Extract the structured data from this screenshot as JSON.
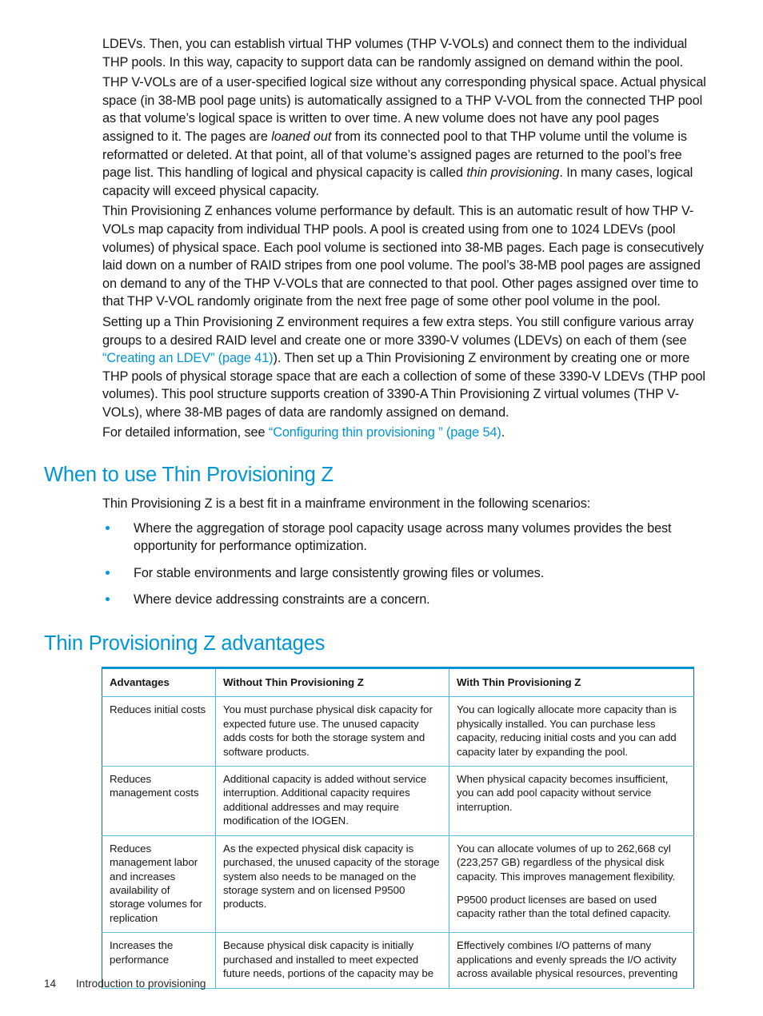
{
  "document": {
    "paragraphs": [
      {
        "id": "p1",
        "runs": [
          {
            "text": "LDEVs. Then, you can establish virtual THP volumes (THP V-VOLs) and connect them to the individual THP pools. In this way, capacity to support data can be randomly assigned on demand within the pool.",
            "style": "normal"
          }
        ]
      },
      {
        "id": "p2",
        "runs": [
          {
            "text": "THP V-VOLs are of a user-specified logical size without any corresponding physical space. Actual physical space (in 38-MB pool page units) is automatically assigned to a THP V-VOL from the connected THP pool as that volume’s logical space is written to over time. A new volume does not have any pool pages assigned to it. The pages are ",
            "style": "normal"
          },
          {
            "text": "loaned out",
            "style": "italic"
          },
          {
            "text": " from its connected pool to that THP volume until the volume is reformatted or deleted. At that point, all of that volume’s assigned pages are returned to the pool’s free page list. This handling of logical and physical capacity is called ",
            "style": "normal"
          },
          {
            "text": "thin provisioning",
            "style": "italic"
          },
          {
            "text": ". In many cases, logical capacity will exceed physical capacity.",
            "style": "normal"
          }
        ]
      },
      {
        "id": "p3",
        "runs": [
          {
            "text": "Thin Provisioning Z enhances volume performance by default. This is an automatic result of how THP V-VOLs map capacity from individual THP pools. A pool is created using from one to 1024 LDEVs (pool volumes) of physical space. Each pool volume is sectioned into 38-MB pages. Each page is consecutively laid down on a number of RAID stripes from one pool volume. The pool’s 38-MB pool pages are assigned on demand to any of the THP V-VOLs that are connected to that pool. Other pages assigned over time to that THP V-VOL randomly originate from the next free page of some other pool volume in the pool.",
            "style": "normal"
          }
        ]
      },
      {
        "id": "p4",
        "runs": [
          {
            "text": "Setting up a Thin Provisioning Z environment requires a few extra steps. You still configure various array groups to a desired RAID level and create one or more 3390-V volumes (LDEVs) on each of them (see ",
            "style": "normal"
          },
          {
            "text": "“Creating an LDEV” (page 41)",
            "style": "link"
          },
          {
            "text": "). Then set up a Thin Provisioning Z environment by creating one or more THP pools of physical storage space that are each a collection of some of these 3390-V LDEVs (THP pool volumes). This pool structure supports creation of 3390-A Thin Provisioning Z virtual volumes (THP V-VOLs), where 38-MB pages of data are randomly assigned on demand.",
            "style": "normal"
          }
        ]
      },
      {
        "id": "p5",
        "runs": [
          {
            "text": "For detailed information, see ",
            "style": "normal"
          },
          {
            "text": "“Configuring thin provisioning ” (page 54)",
            "style": "link"
          },
          {
            "text": ".",
            "style": "normal"
          }
        ]
      }
    ],
    "heading_when_to_use": "When to use Thin Provisioning Z",
    "intro_when_to_use": "Thin Provisioning Z is a best fit in a mainframe environment in the following scenarios:",
    "bullets": [
      "Where the aggregation of storage pool capacity usage across many volumes provides the best opportunity for performance optimization.",
      "For stable environments and large consistently growing files or volumes.",
      "Where device addressing constraints are a concern."
    ],
    "heading_advantages": "Thin Provisioning Z advantages",
    "table": {
      "headers": [
        "Advantages",
        "Without Thin Provisioning Z",
        "With Thin Provisioning Z"
      ],
      "rows": [
        {
          "advantage": "Reduces initial costs",
          "without": [
            "You must purchase physical disk capacity for expected future use. The unused capacity adds costs for both the storage system and software products."
          ],
          "with": [
            "You can logically allocate more capacity than is physically installed. You can purchase less capacity, reducing initial costs and you can add capacity later by expanding the pool."
          ]
        },
        {
          "advantage": "Reduces management costs",
          "without": [
            "Additional capacity is added without service interruption. Additional capacity requires additional addresses and may require modification of the IOGEN."
          ],
          "with": [
            "When physical capacity becomes insufficient, you can add pool capacity without service interruption."
          ]
        },
        {
          "advantage": "Reduces management labor and increases availability of storage volumes for replication",
          "without": [
            "As the expected physical disk capacity is purchased, the unused capacity of the storage system also needs to be managed on the storage system and on licensed P9500 products."
          ],
          "with": [
            "You can allocate volumes of up to 262,668 cyl (223,257 GB) regardless of the physical disk capacity. This improves management flexibility.",
            "P9500 product licenses are based on used capacity rather than the total defined capacity."
          ]
        },
        {
          "advantage": "Increases the performance",
          "without": [
            "Because physical disk capacity is initially purchased and installed to meet expected future needs, portions of the capacity may be"
          ],
          "with": [
            "Effectively combines I/O patterns of many applications and evenly spreads the I/O activity across available physical resources, preventing"
          ]
        }
      ]
    },
    "footer": {
      "page_number": "14",
      "title": "Introduction to provisioning"
    },
    "colors": {
      "accent_blue": "#0096d6",
      "link_blue": "#0096d6",
      "table_border_light": "#4db8e8",
      "table_border_dark": "#1b5faa",
      "body_text": "#161616"
    }
  }
}
